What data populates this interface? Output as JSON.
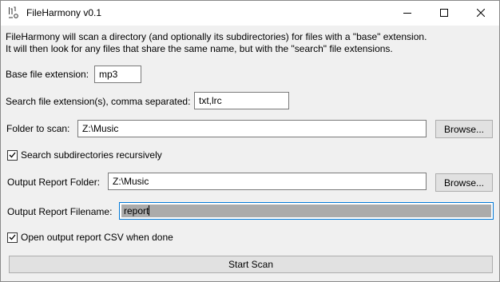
{
  "window": {
    "title": "FileHarmony v0.1",
    "app_icon": "file-harmony-icon",
    "controls": [
      "minimize-icon",
      "maximize-icon",
      "close-icon"
    ]
  },
  "description": {
    "line1": "FileHarmony will scan a directory (and optionally its subdirectories) for files with a \"base\" extension.",
    "line2": "It will then look for any files that share the same name, but with the \"search\" file extensions."
  },
  "base_extension": {
    "label": "Base file extension:",
    "value": "mp3"
  },
  "search_extensions": {
    "label": "Search file extension(s), comma separated:",
    "value": "txt,lrc"
  },
  "scan_folder": {
    "label": "Folder to scan:",
    "value": "Z:\\Music",
    "browse_label": "Browse..."
  },
  "recursive": {
    "label": "Search subdirectories recursively",
    "checked": true
  },
  "output_folder": {
    "label": "Output Report Folder:",
    "value": "Z:\\Music",
    "browse_label": "Browse..."
  },
  "output_filename": {
    "label": "Output Report Filename:",
    "value": "report"
  },
  "open_csv": {
    "label": "Open output report CSV when done",
    "checked": true
  },
  "start_button": {
    "label": "Start Scan"
  },
  "colors": {
    "focus_border": "#0078d7",
    "selection": "#ababab",
    "button_face": "#e1e1e1",
    "window_bg": "#f0f0f0"
  }
}
